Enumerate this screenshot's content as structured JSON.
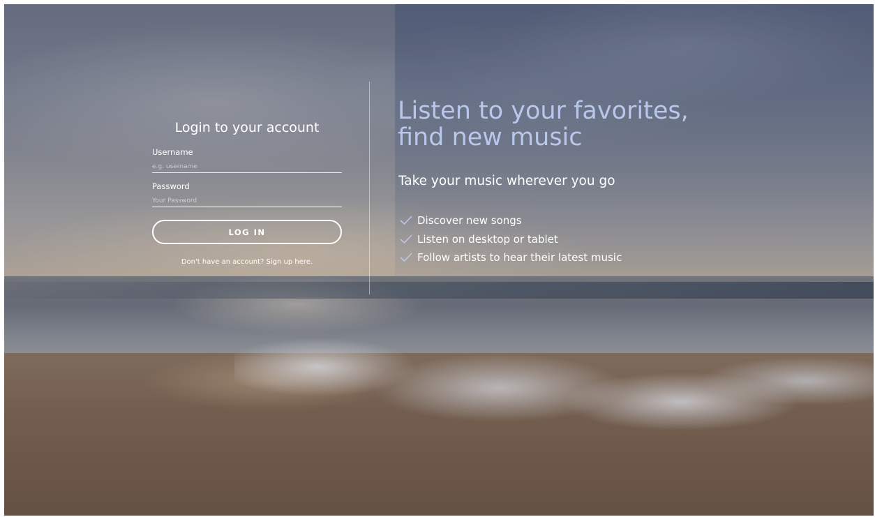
{
  "login": {
    "title": "Login to your account",
    "username_label": "Username",
    "username_placeholder": "e.g. username",
    "username_value": "",
    "password_label": "Password",
    "password_placeholder": "Your Password",
    "password_value": "",
    "button_label": "LOG IN",
    "signup_text": "Don't have an account? Sign up here."
  },
  "hero": {
    "title_line1": "Listen to your favorites,",
    "title_line2": "find new music",
    "subtitle": "Take your music wherever you go",
    "features": [
      {
        "icon": "check-icon",
        "label": "Discover new songs"
      },
      {
        "icon": "check-icon",
        "label": "Listen on desktop or tablet"
      },
      {
        "icon": "check-icon",
        "label": "Follow artists to hear their latest music"
      }
    ]
  },
  "colors": {
    "hero_title": "#b9c7ea",
    "check_icon": "#b9c7ea",
    "text": "#ffffff"
  }
}
